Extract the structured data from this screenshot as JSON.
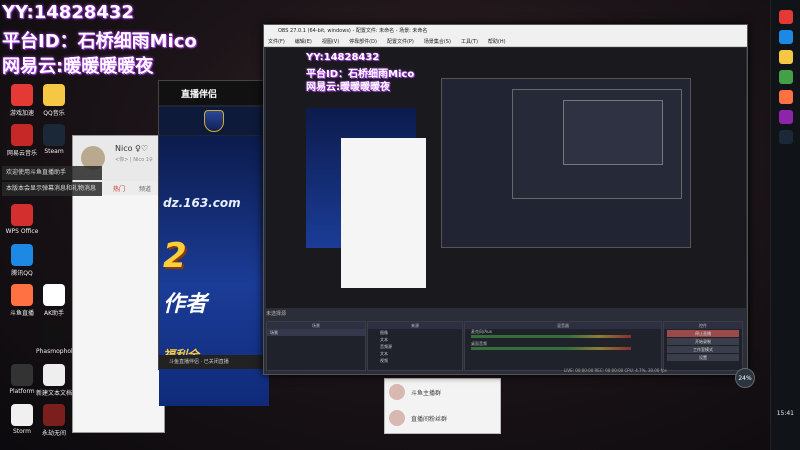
{
  "overlay": {
    "line1": "YY:14828432",
    "line2": "平台ID：石桥细雨Mico",
    "line3": "网易云:暖暖暖暖夜"
  },
  "desktop_icons": [
    {
      "label": "游戏加速",
      "color": "#e53935"
    },
    {
      "label": "QQ音乐",
      "color": "#f6c744"
    },
    {
      "label": "网易云音乐",
      "color": "#c62828"
    },
    {
      "label": "Steam",
      "color": "#1b2838"
    },
    {
      "label": "WPS Office",
      "color": "#d32f2f"
    },
    {
      "label": "腾讯QQ",
      "color": "#1e88e5"
    },
    {
      "label": "斗鱼直播",
      "color": "#ff7043"
    },
    {
      "label": "AK助手",
      "color": "#ffffff"
    },
    {
      "label": "Phasmophobia",
      "color": "#111111"
    },
    {
      "label": "Platform",
      "color": "#333333"
    },
    {
      "label": "新建文本文档",
      "color": "#eeeeee"
    },
    {
      "label": "Storm",
      "color": "#f0f0f0"
    },
    {
      "label": "永劫无间",
      "color": "#7b1e1e"
    }
  ],
  "chat_window": {
    "name": "Nico ♀♡",
    "status": "<你> | Nico 1♀",
    "tabs": [
      "热门",
      "频道"
    ]
  },
  "toasts": [
    "欢迎使用斗鱼直播助手",
    "本版本会显示弹幕消息和礼物消息"
  ],
  "live_window": {
    "title": "直播伴侣",
    "url": "dz.163.com",
    "big": "2",
    "big2": "作者",
    "sub": "福利全",
    "footer": "斗鱼直播伴侣 · 已关闭直播"
  },
  "group_list": [
    {
      "name": "斗鱼主播群"
    },
    {
      "name": "直播间粉丝群"
    }
  ],
  "obs": {
    "title": "OBS 27.0.1 (64-bit, windows) - 配置文件: 未命名 - 场景: 未命名",
    "menu": [
      "文件(F)",
      "编辑(E)",
      "视图(V)",
      "停靠部件(D)",
      "配置文件(P)",
      "场景集合(S)",
      "工具(T)",
      "帮助(H)"
    ],
    "preview_overlay": [
      "YY:14828432",
      "平台ID：石桥细雨Mico",
      "网易云:暖暖暖暖夜"
    ],
    "scene_label": "未选择源",
    "panels": {
      "scenes": "场景",
      "sources": "来源",
      "mixer": "混音器",
      "controls": "控件"
    },
    "scenes": [
      "场景"
    ],
    "sources": [
      "图像",
      "文本",
      "音频源",
      "文本",
      "视频",
      "Text 1"
    ],
    "mixer": [
      "麦克风/Aux",
      "桌面音频"
    ],
    "controls": [
      "停止直播",
      "开始录制",
      "工作室模式",
      "设置",
      "退出"
    ],
    "status": "LIVE: 00:00:00   REC: 00:00:00   CPU: 4.7%, 30.00 fps"
  },
  "taskbar_badge": "24%",
  "clock": "15:41"
}
